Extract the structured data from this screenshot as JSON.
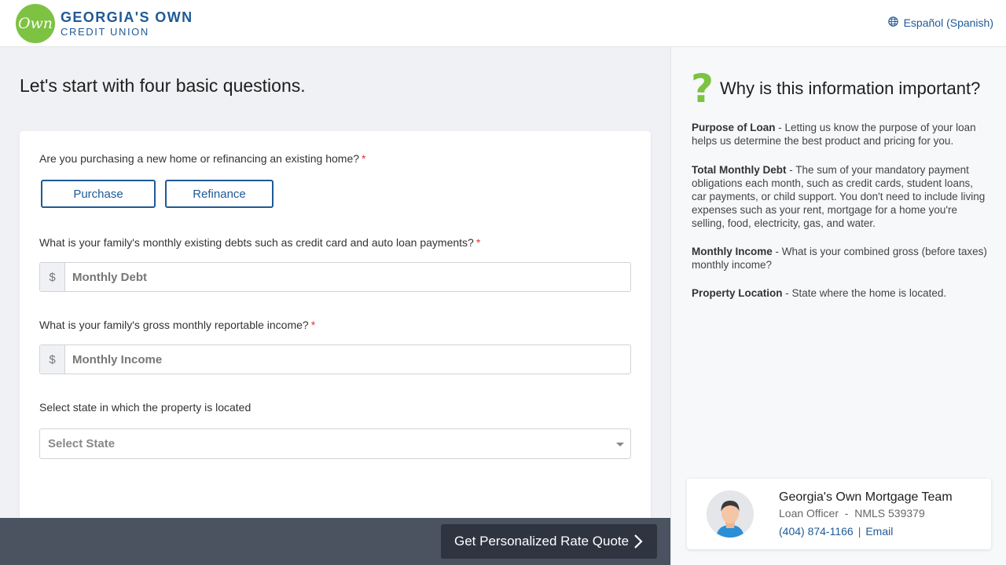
{
  "header": {
    "logo_mark": "Own",
    "logo_line1": "GEORGIA'S OWN",
    "logo_line2": "CREDIT UNION",
    "language_link": "Español (Spanish)"
  },
  "main": {
    "title": "Let's start with four basic questions.",
    "q1": {
      "label": "Are you purchasing a new home or refinancing an existing home?",
      "required": "*",
      "options": [
        "Purchase",
        "Refinance"
      ]
    },
    "q2": {
      "label": "What is your family's monthly existing debts such as credit card and auto loan payments?",
      "required": "*",
      "addon": "$",
      "placeholder": "Monthly Debt"
    },
    "q3": {
      "label": "What is your family's gross monthly reportable income?",
      "required": "*",
      "addon": "$",
      "placeholder": "Monthly Income"
    },
    "q4": {
      "label": "Select state in which the property is located",
      "select_value": "Select State"
    },
    "cta": "Get Personalized Rate Quote"
  },
  "side": {
    "icon": "?",
    "title": "Why is this information important?",
    "items": [
      {
        "term": "Purpose of Loan",
        "desc": " - Letting us know the purpose of your loan helps us determine the best product and pricing for you."
      },
      {
        "term": "Total Monthly Debt",
        "desc": " - The sum of your mandatory payment obligations each month, such as credit cards, student loans, car payments, or child support. You don't need to include living expenses such as your rent, mortgage for a home you're selling, food, electricity, gas, and water."
      },
      {
        "term": "Monthly Income",
        "desc": " - What is your combined gross (before taxes) monthly income?"
      },
      {
        "term": "Property Location",
        "desc": " - State where the home is located."
      }
    ],
    "contact": {
      "name": "Georgia's Own Mortgage Team",
      "role": "Loan Officer  -  NMLS 539379",
      "phone": "(404) 874-1166",
      "separator": "|",
      "email": "Email"
    }
  },
  "colors": {
    "brand_green": "#7dc242",
    "brand_blue": "#1f5a96",
    "footer_bar": "#4b5260",
    "cta_bg": "#2e3440"
  }
}
